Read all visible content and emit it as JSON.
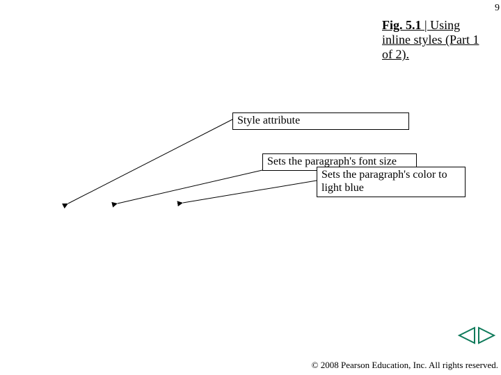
{
  "page_number": "9",
  "title": {
    "fig": "Fig. 5.1 ",
    "rest": "| Using inline styles (Part 1 of 2)."
  },
  "callouts": {
    "style_attr": "Style attribute",
    "font_size": "Sets the paragraph's font size",
    "color": "Sets the paragraph's color to light blue"
  },
  "nav": {
    "prev": "previous slide",
    "next": "next slide",
    "color": "#0f7a5a"
  },
  "footer": {
    "copyright": "© 2008 Pearson Education, Inc.  All rights reserved."
  }
}
